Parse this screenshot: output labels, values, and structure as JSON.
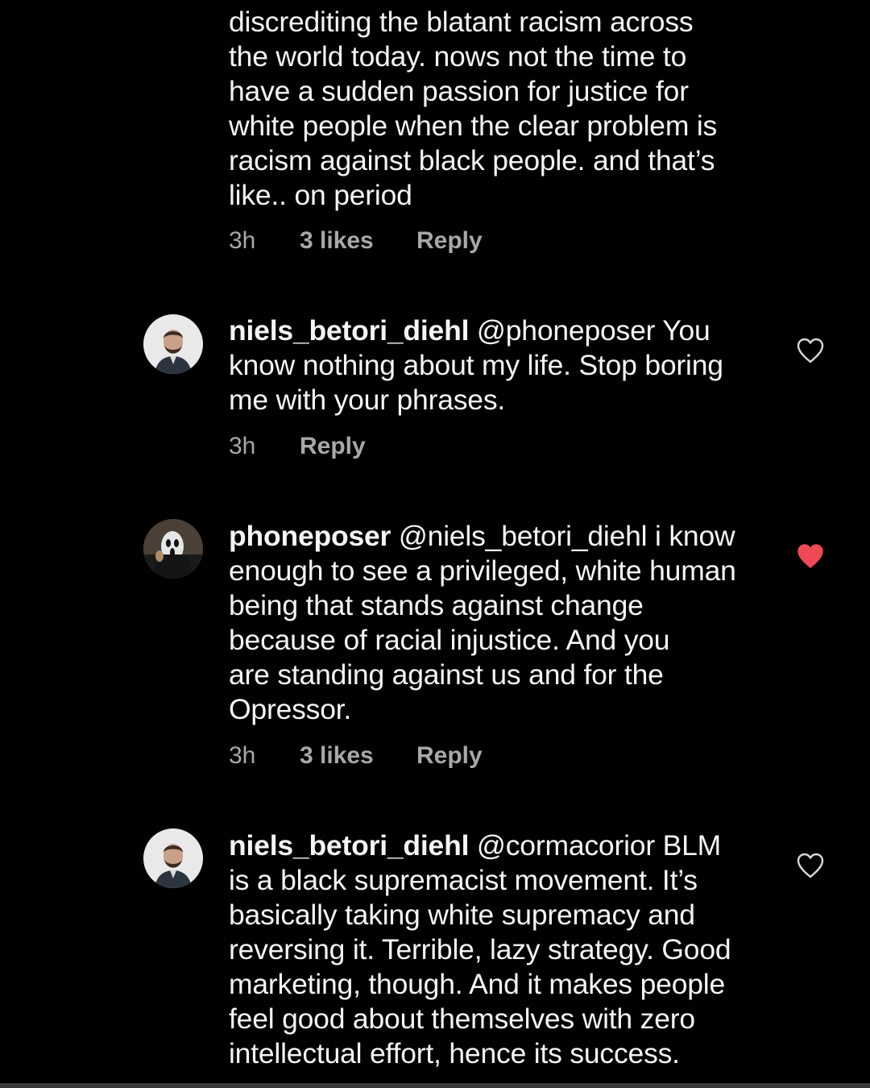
{
  "comments": [
    {
      "text_lines": [
        "discrediting the blatant racism across",
        "the world today. nows not the time to",
        "have a sudden passion for justice for",
        "white people when the clear problem is",
        "racism against black people. and that’s",
        "like.. on period"
      ],
      "time": "3h",
      "likes": "3 likes",
      "reply": "Reply"
    },
    {
      "username": "niels_betori_diehl",
      "first_line_rest": " @phoneposer You",
      "text_lines": [
        "know nothing about my life. Stop boring",
        "me with your phrases."
      ],
      "time": "3h",
      "reply": "Reply",
      "liked": false
    },
    {
      "username": "phoneposer",
      "first_line_rest": " @niels_betori_diehl i know",
      "text_lines": [
        "enough to see a privileged, white human",
        "being that stands against change",
        "because of racial injustice.  And you",
        "are standing against us and for the",
        "Opressor."
      ],
      "time": "3h",
      "likes": "3 likes",
      "reply": "Reply",
      "liked": true
    },
    {
      "username": "niels_betori_diehl",
      "first_line_rest": " @cormacorior BLM",
      "text_lines": [
        "is a black supremacist movement. It’s",
        "basically taking white supremacy and",
        "reversing it. Terrible, lazy strategy. Good",
        "marketing, though. And it makes people",
        "feel good about themselves with zero",
        "intellectual effort, hence its success."
      ],
      "liked": false
    }
  ],
  "colors": {
    "background": "#000000",
    "text": "#f5f5f5",
    "meta": "#a8a8a8",
    "heart_liked": "#ed4956",
    "heart_outline": "#d8d8d8"
  },
  "icons": {
    "like": "heart-icon",
    "liked": "heart-filled-icon"
  }
}
